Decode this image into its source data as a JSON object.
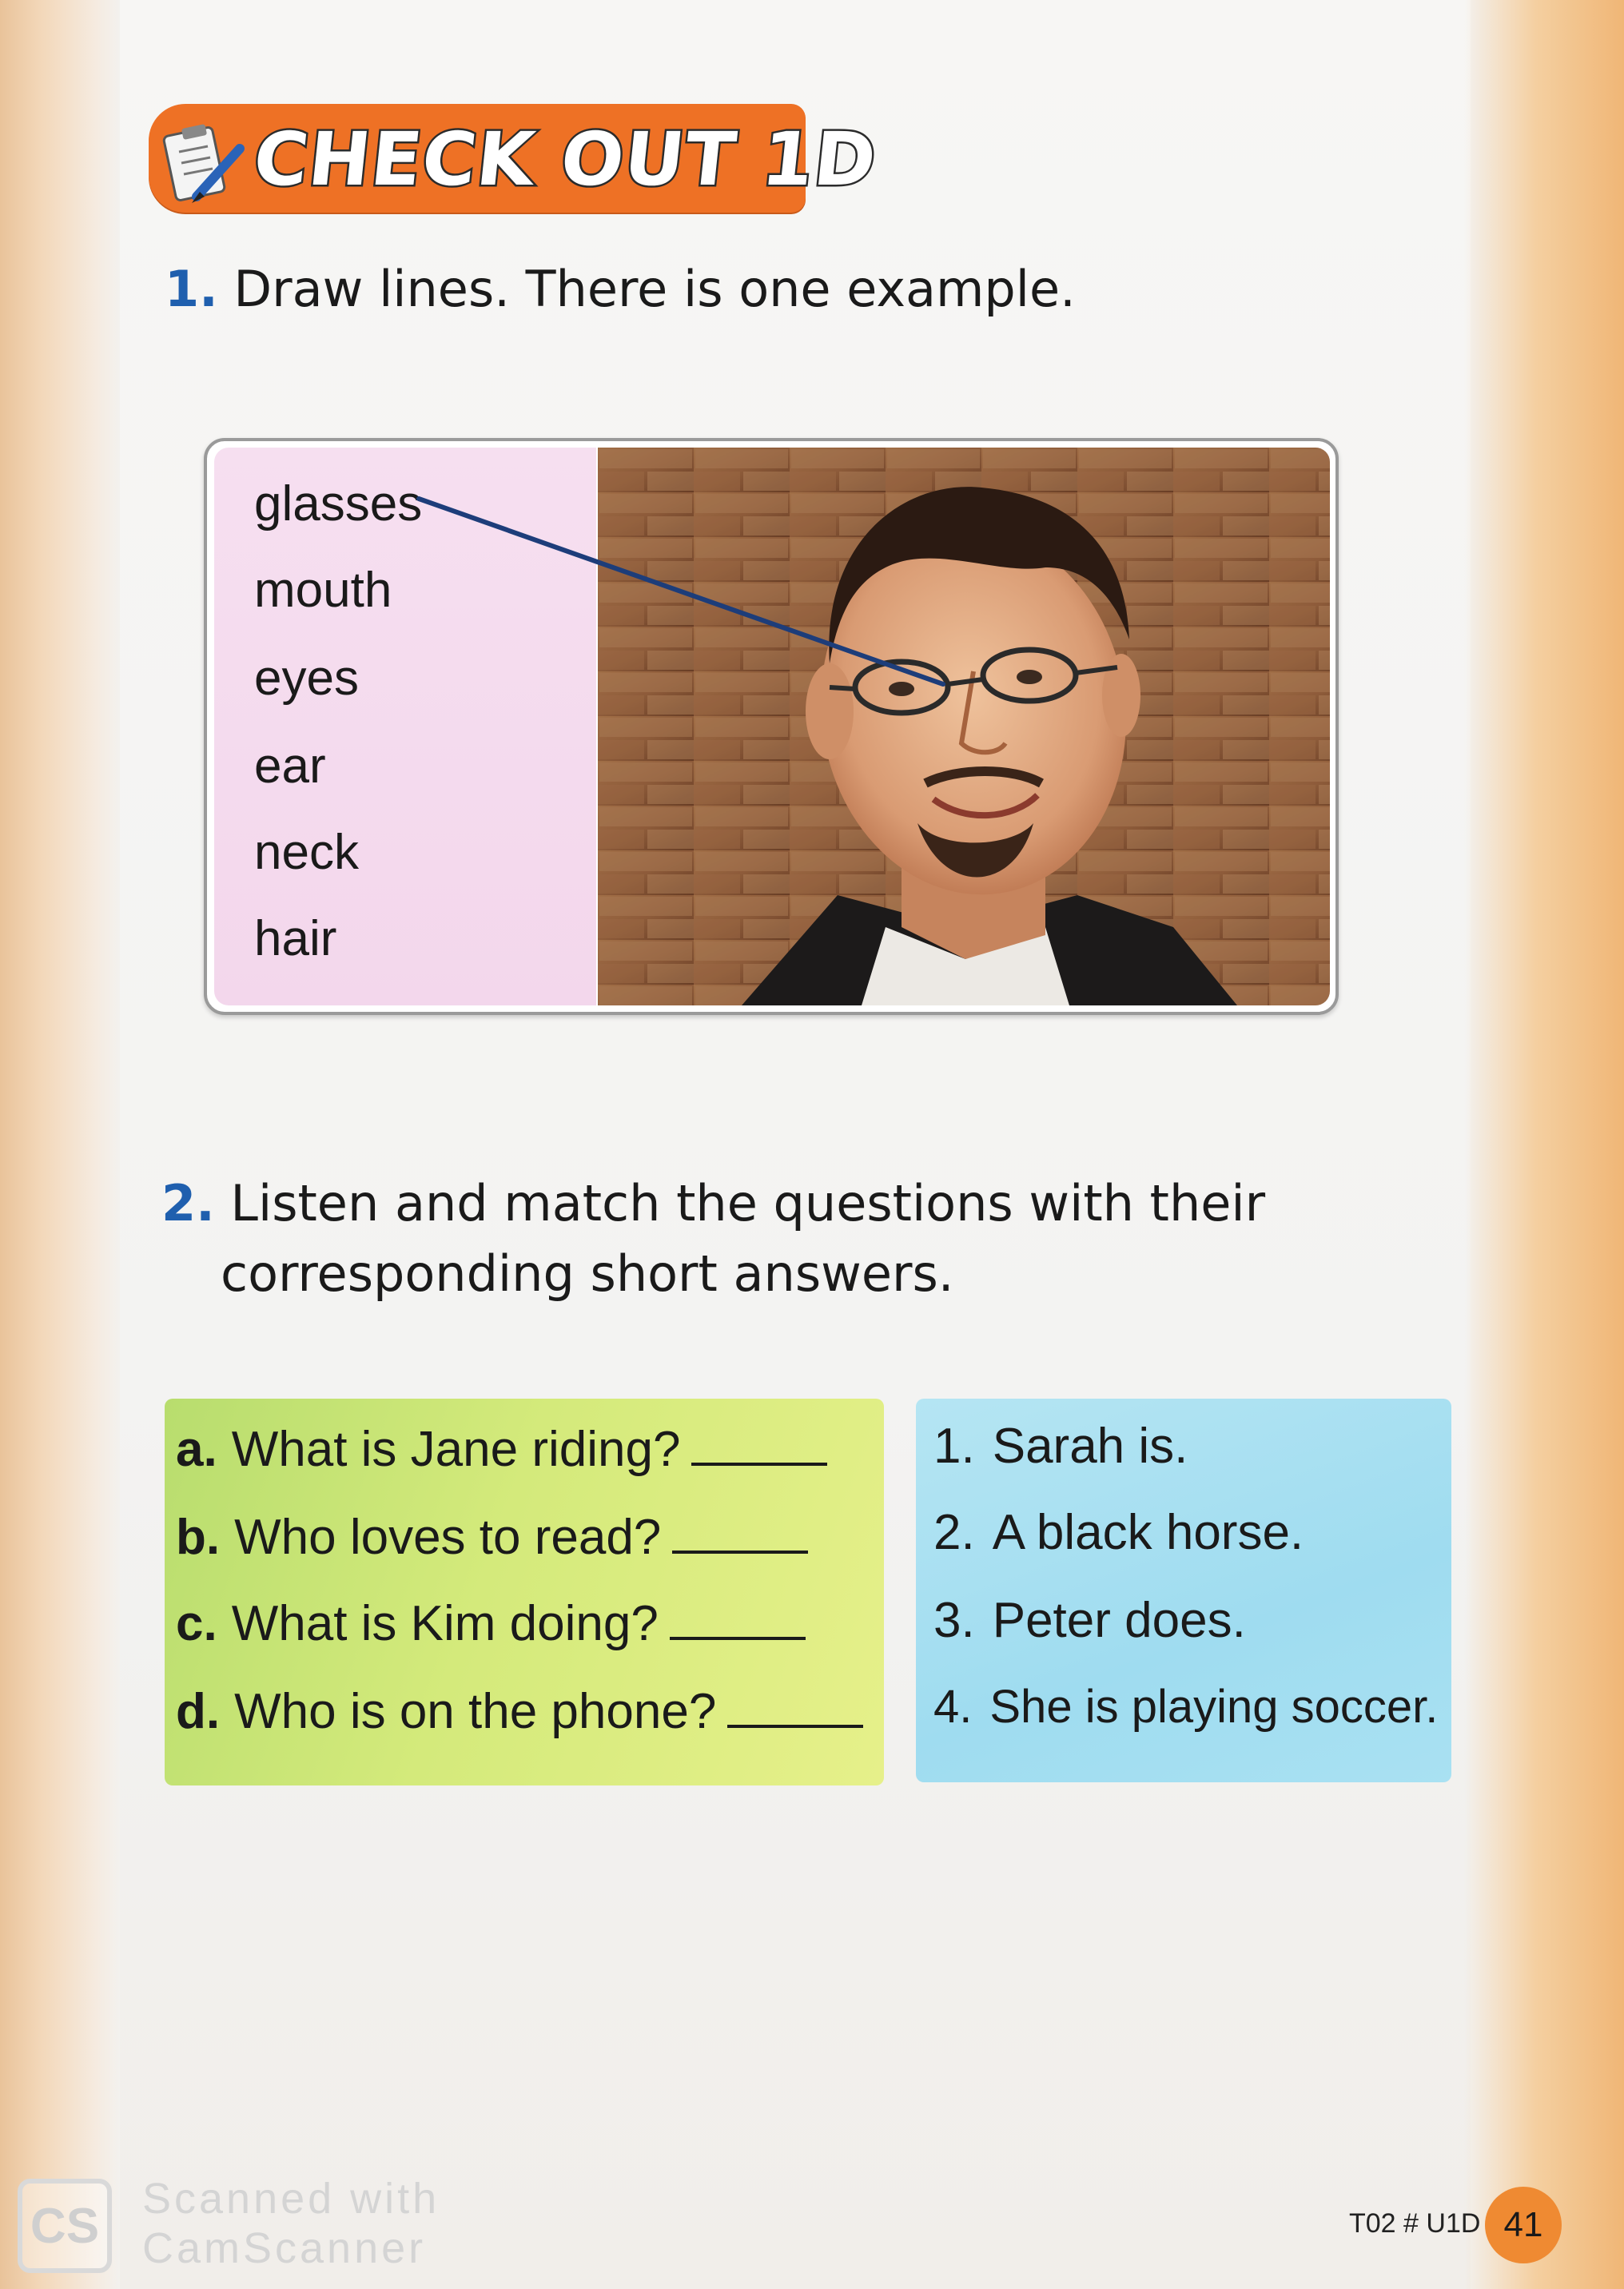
{
  "header": {
    "title": "CHECK OUT 1D",
    "icon": "clipboard-pen-icon",
    "banner_color": "#ee7125"
  },
  "exercise1": {
    "number": "1.",
    "instruction": "Draw lines. There is one example.",
    "words": [
      "glasses",
      "mouth",
      "eyes",
      "ear",
      "neck",
      "hair"
    ],
    "example_match": "glasses",
    "image": "portrait-photo"
  },
  "exercise2": {
    "number": "2.",
    "instruction_line1": "Listen and match the questions with their",
    "instruction_line2": "corresponding short answers.",
    "questions": [
      {
        "letter": "a.",
        "text": "What is Jane riding?"
      },
      {
        "letter": "b.",
        "text": "Who loves to read?"
      },
      {
        "letter": "c.",
        "text": "What is Kim doing?"
      },
      {
        "letter": "d.",
        "text": "Who is on the phone?"
      }
    ],
    "answers": [
      {
        "number": "1.",
        "text": "Sarah is."
      },
      {
        "number": "2.",
        "text": "A black horse."
      },
      {
        "number": "3.",
        "text": "Peter does."
      },
      {
        "number": "4.",
        "text": "She is playing soccer."
      }
    ],
    "question_box_color": "#cfe87a",
    "answer_box_color": "#a9e1f2"
  },
  "footer": {
    "scanner_logo": "CS",
    "scanner_line1": "Scanned with",
    "scanner_line2": "CamScanner",
    "page_code": "T02 # U1D",
    "page_number": "41"
  }
}
